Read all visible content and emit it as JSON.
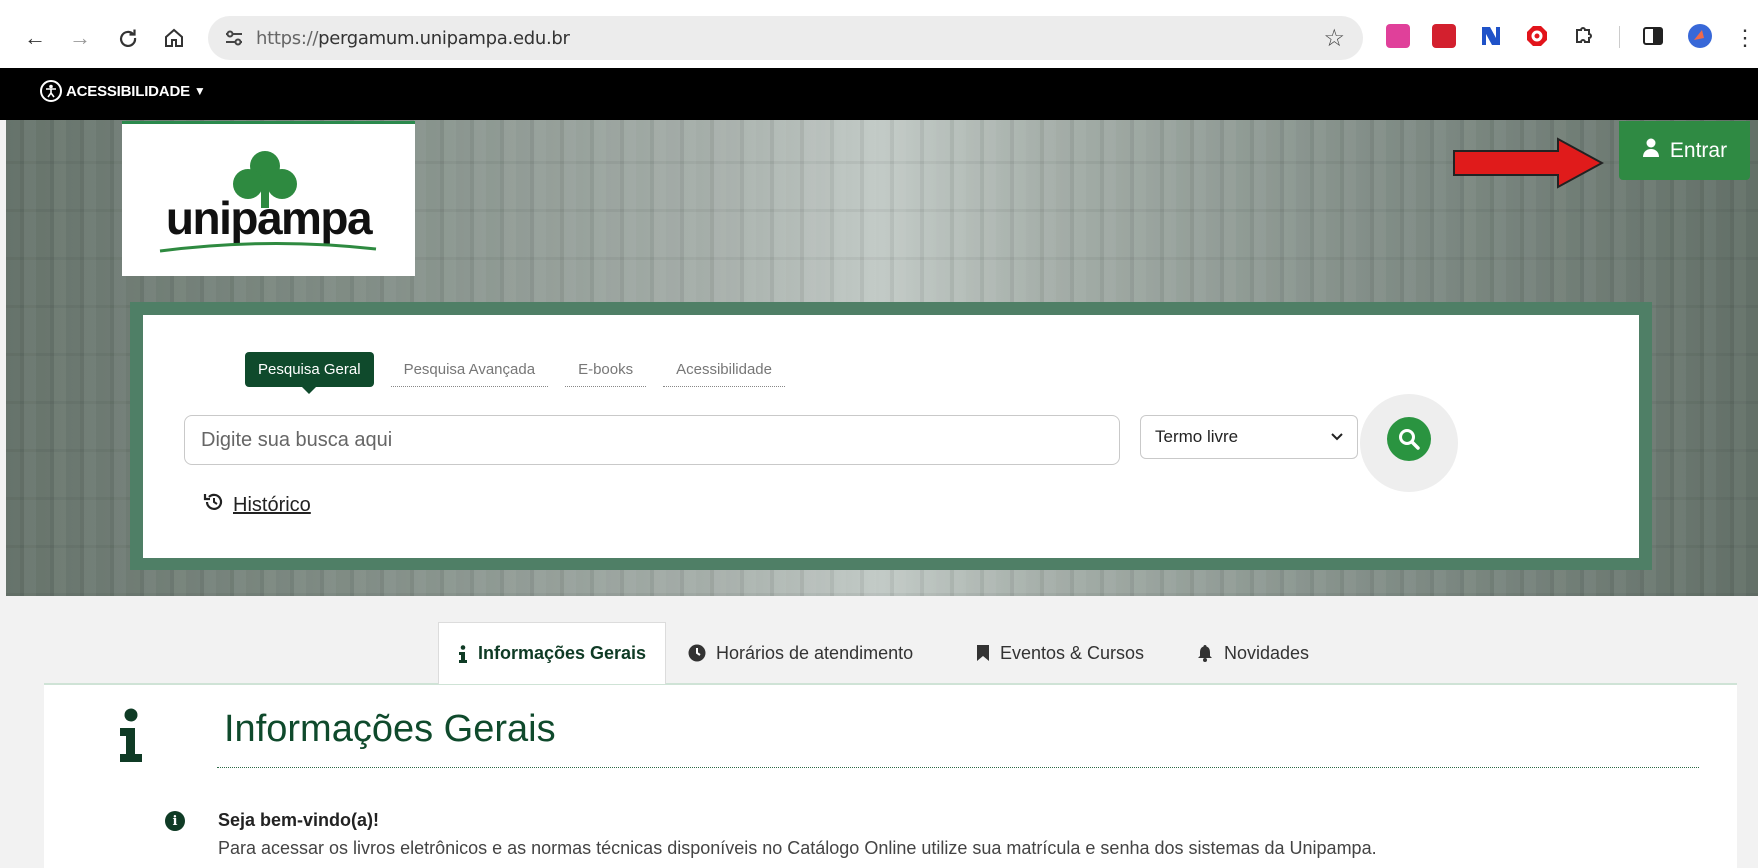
{
  "browser": {
    "url_scheme": "https://",
    "url_host": "pergamum.unipampa.edu.br",
    "back": "←",
    "forward": "→",
    "reload": "↻",
    "home": "⌂",
    "star": "☆",
    "menu": "⋮"
  },
  "accessibility_bar": {
    "label": "ACESSIBILIDADE"
  },
  "hero": {
    "logo_text": "unipampa",
    "login_label": "Entrar"
  },
  "search": {
    "tabs": [
      {
        "label": "Pesquisa Geral",
        "active": true
      },
      {
        "label": "Pesquisa Avançada"
      },
      {
        "label": "E-books"
      },
      {
        "label": "Acessibilidade"
      }
    ],
    "placeholder": "Digite sua busca aqui",
    "select_value": "Termo livre",
    "history_label": "Histórico"
  },
  "info_tabs": [
    {
      "label": "Informações Gerais",
      "icon": "info-icon",
      "active": true
    },
    {
      "label": "Horários de atendimento",
      "icon": "clock-icon"
    },
    {
      "label": "Eventos & Cursos",
      "icon": "bookmark-icon"
    },
    {
      "label": "Novidades",
      "icon": "bell-icon"
    }
  ],
  "content": {
    "title": "Informações Gerais",
    "welcome_title": "Seja bem-vindo(a)!",
    "welcome_text": "Para acessar os livros eletrônicos e as normas técnicas disponíveis no Catálogo Online utilize sua matrícula e senha dos sistemas da Unipampa."
  },
  "colors": {
    "brand_green": "#0f4a2c",
    "button_green": "#2f8a43",
    "arrow_red": "#e01b1b"
  }
}
